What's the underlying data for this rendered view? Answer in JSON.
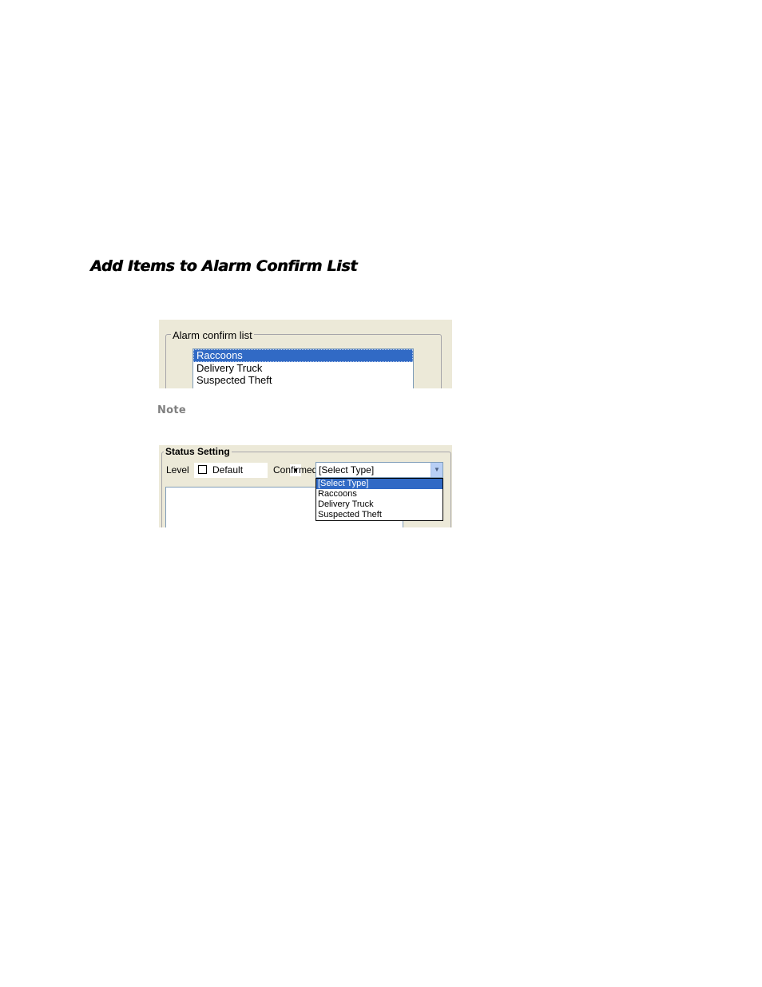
{
  "section": {
    "heading": "Add Items to Alarm Confirm List",
    "note_label": "Note"
  },
  "alarm_confirm_panel": {
    "group_label": "Alarm confirm list",
    "items": [
      {
        "label": "Raccoons",
        "selected": true
      },
      {
        "label": "Delivery Truck",
        "selected": false
      },
      {
        "label": "Suspected Theft",
        "selected": false
      }
    ]
  },
  "status_panel": {
    "group_label": "Status Setting",
    "level_label": "Level",
    "level_value": "Default",
    "confirmed_label": "Confirmed",
    "confirmed_value": "[Select Type]",
    "options": [
      {
        "label": "[Select Type]",
        "selected": true
      },
      {
        "label": "Raccoons",
        "selected": false
      },
      {
        "label": "Delivery Truck",
        "selected": false
      },
      {
        "label": "Suspected Theft",
        "selected": false
      }
    ]
  },
  "colors": {
    "selection": "#316ac5",
    "dialog_bg": "#ece9d8",
    "note_gray": "#7f7f7f"
  }
}
